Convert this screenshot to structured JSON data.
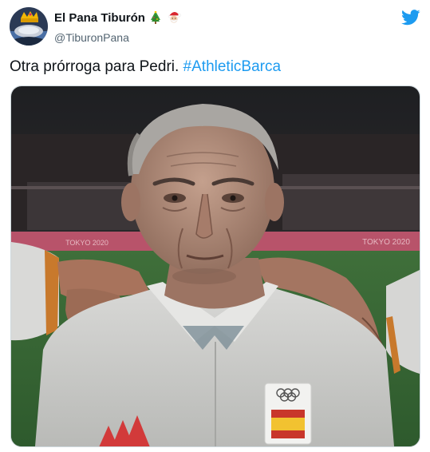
{
  "author": {
    "display_name": "El Pana Tiburón",
    "handle": "@TiburonPana",
    "name_emojis": [
      "christmas-tree-icon",
      "santa-icon"
    ]
  },
  "brand": {
    "logo": "twitter-bird-icon",
    "color": "#1d9bf0"
  },
  "tweet": {
    "text": "Otra prórroga para Pedri.",
    "hashtag": "#AthleticBarca"
  },
  "media": {
    "type": "photo",
    "description_icons": [
      "adidas-logo-icon",
      "olympic-rings-icon",
      "spain-flag-patch-icon"
    ],
    "stadium_board_text": [
      "TOKYO 2020",
      "TOKYO 2020"
    ]
  },
  "colors": {
    "text": "#0f1419",
    "secondary": "#536471",
    "link": "#1d9bf0"
  }
}
